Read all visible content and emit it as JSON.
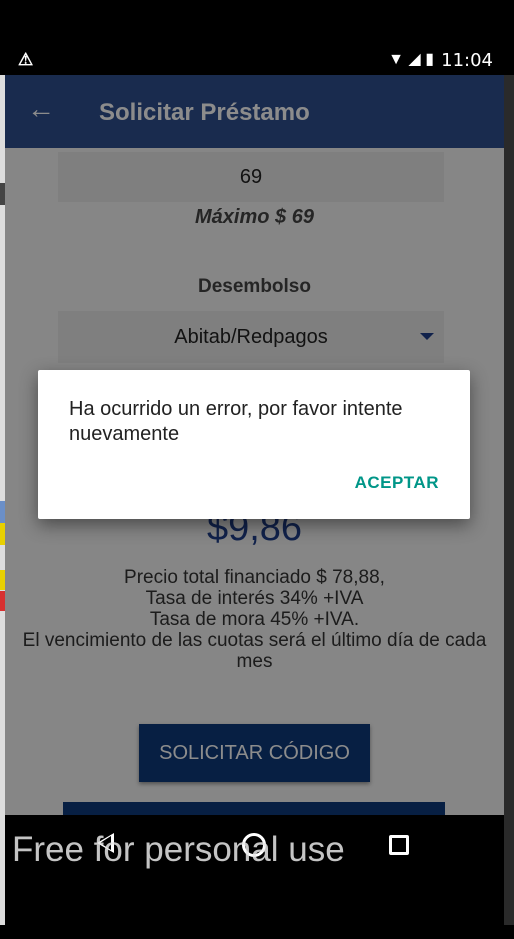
{
  "status_bar": {
    "time": "11:04",
    "icons": [
      "warning-icon",
      "wifi-icon",
      "signal-icon",
      "battery-icon"
    ]
  },
  "app_bar": {
    "title": "Solicitar Préstamo"
  },
  "form": {
    "amount_value": "69",
    "max_label": "Máximo $ 69",
    "disbursement_label": "Desembolso",
    "disbursement_value": "Abitab/Redpagos"
  },
  "summary": {
    "quota": "$9,86",
    "total_financed": "Precio total financiado $ 78,88,",
    "interest_rate": "Tasa de interés 34% +IVA",
    "late_rate": "Tasa de mora 45% +IVA.",
    "due_note": "El vencimiento de las cuotas será el último día de cada mes"
  },
  "buttons": {
    "request_code": "SOLICITAR CÓDIGO"
  },
  "dialog": {
    "message": "Ha ocurrido un error, por favor intente nuevamente",
    "accept": "ACEPTAR"
  },
  "watermark": "Free for personal use",
  "colors": {
    "app_bar": "#2e4f8e",
    "primary_button": "#0d3a7a",
    "dialog_action": "#009688",
    "quota_text": "#1f3f8a"
  }
}
